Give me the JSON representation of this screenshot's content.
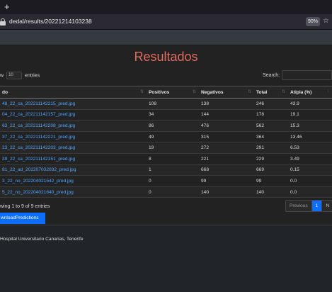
{
  "browser": {
    "newtab_glyph": "+",
    "url": "dedal/results/20221214103238",
    "zoom": "90%",
    "star_glyph": "☆"
  },
  "page": {
    "title": "Resultados",
    "length_prefix": "w",
    "length_value": "10",
    "length_suffix": "entries",
    "search_label": "Search:"
  },
  "table": {
    "headers": [
      "do",
      "Positivos",
      "Negativos",
      "Total",
      "Atipia (%)"
    ],
    "rows": [
      {
        "file": "48_22_ca_202211142215_pred.jpg",
        "pos": "108",
        "neg": "138",
        "total": "246",
        "atipia": "43.9"
      },
      {
        "file": "04_22_ca_202211142157_pred.jpg",
        "pos": "34",
        "neg": "144",
        "total": "178",
        "atipia": "19.1"
      },
      {
        "file": "63_22_ca_202211142208_pred.jpg",
        "pos": "86",
        "neg": "476",
        "total": "562",
        "atipia": "15.3"
      },
      {
        "file": "37_22_ca_202211142221_pred.jpg",
        "pos": "49",
        "neg": "315",
        "total": "364",
        "atipia": "13.46"
      },
      {
        "file": "23_22_ca_202211142203_pred.jpg",
        "pos": "19",
        "neg": "272",
        "total": "291",
        "atipia": "6.53"
      },
      {
        "file": "39_22_ca_202211142151_pred.jpg",
        "pos": "8",
        "neg": "221",
        "total": "229",
        "atipia": "3.49"
      },
      {
        "file": "81_22_ad_202207032032_pred.jpg",
        "pos": "1",
        "neg": "668",
        "total": "669",
        "atipia": "0.15"
      },
      {
        "file": "3_22_no_202204021542_pred.jpg",
        "pos": "0",
        "neg": "99",
        "total": "99",
        "atipia": "0.0"
      },
      {
        "file": "5_22_no_202204021640_pred.jpg",
        "pos": "0",
        "neg": "140",
        "total": "140",
        "atipia": "0.0"
      }
    ]
  },
  "info": "wing 1 to 9 of 9 entries",
  "pager": {
    "previous": "Previous",
    "current": "1",
    "next": "N"
  },
  "download_label": "wnloadPredictions",
  "footer": "Hospital Universitario Canarias, Tenerife"
}
